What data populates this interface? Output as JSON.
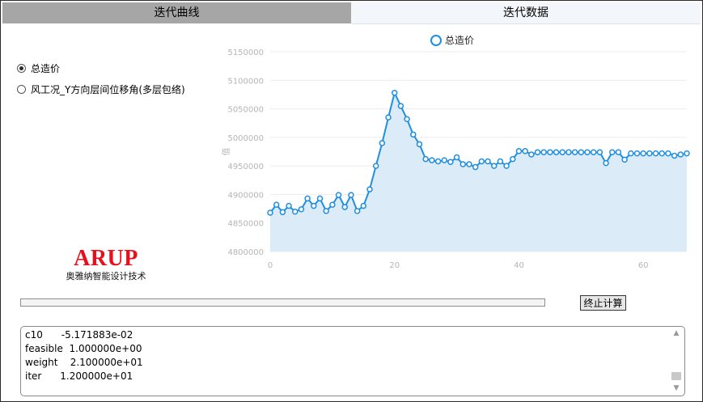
{
  "tabs": [
    {
      "label": "迭代曲线",
      "selected": false
    },
    {
      "label": "迭代数据",
      "selected": true
    }
  ],
  "options": [
    {
      "label": "总造价",
      "checked": true
    },
    {
      "label": "风工况_Y方向层间位移角(多层包络)",
      "checked": false
    }
  ],
  "logo": {
    "mark": "ARUP",
    "subtitle": "奥雅纳智能设计技术"
  },
  "progress": {
    "fraction": 0
  },
  "stop_button": {
    "label": "终止计算"
  },
  "log": {
    "lines": [
      "c10      -5.171883e-02",
      "feasible  1.000000e+00",
      "weight    2.100000e+01",
      "iter      1.200000e+01"
    ]
  },
  "colors": {
    "series": "#1f8fe0",
    "area": "#dcebf8",
    "grid": "#ececec",
    "tick": "#b5b5b5"
  },
  "chart_data": {
    "type": "area",
    "legend": "top-center",
    "ylabel": "值",
    "grid": true,
    "xlim": [
      0,
      67
    ],
    "ylim": [
      4800000,
      5150000
    ],
    "x_ticks": [
      0,
      20,
      40,
      60
    ],
    "y_ticks": [
      4800000,
      4850000,
      4900000,
      4950000,
      5000000,
      5050000,
      5100000,
      5150000
    ],
    "series": [
      {
        "name": "总造价",
        "x": [
          0,
          1,
          2,
          3,
          4,
          5,
          6,
          7,
          8,
          9,
          10,
          11,
          12,
          13,
          14,
          15,
          16,
          17,
          18,
          19,
          20,
          21,
          22,
          23,
          24,
          25,
          26,
          27,
          28,
          29,
          30,
          31,
          32,
          33,
          34,
          35,
          36,
          37,
          38,
          39,
          40,
          41,
          42,
          43,
          44,
          45,
          46,
          47,
          48,
          49,
          50,
          51,
          52,
          53,
          54,
          55,
          56,
          57,
          58,
          59,
          60,
          61,
          62,
          63,
          64,
          65,
          66,
          67
        ],
        "y": [
          4868000,
          4882000,
          4869000,
          4880000,
          4870000,
          4874000,
          4893000,
          4880000,
          4893000,
          4871000,
          4882000,
          4899000,
          4878000,
          4899000,
          4871000,
          4880000,
          4909000,
          4950000,
          4990000,
          5035000,
          5078000,
          5055000,
          5032000,
          5005000,
          4988000,
          4962000,
          4960000,
          4958000,
          4960000,
          4957000,
          4965000,
          4953000,
          4953000,
          4948000,
          4958000,
          4958000,
          4950000,
          4958000,
          4950000,
          4962000,
          4976000,
          4976000,
          4970000,
          4974000,
          4974000,
          4974000,
          4974000,
          4974000,
          4974000,
          4974000,
          4974000,
          4974000,
          4974000,
          4974000,
          4955000,
          4974000,
          4974000,
          4961000,
          4972000,
          4972000,
          4972000,
          4972000,
          4972000,
          4972000,
          4972000,
          4968000,
          4970000,
          4972000
        ]
      }
    ]
  }
}
